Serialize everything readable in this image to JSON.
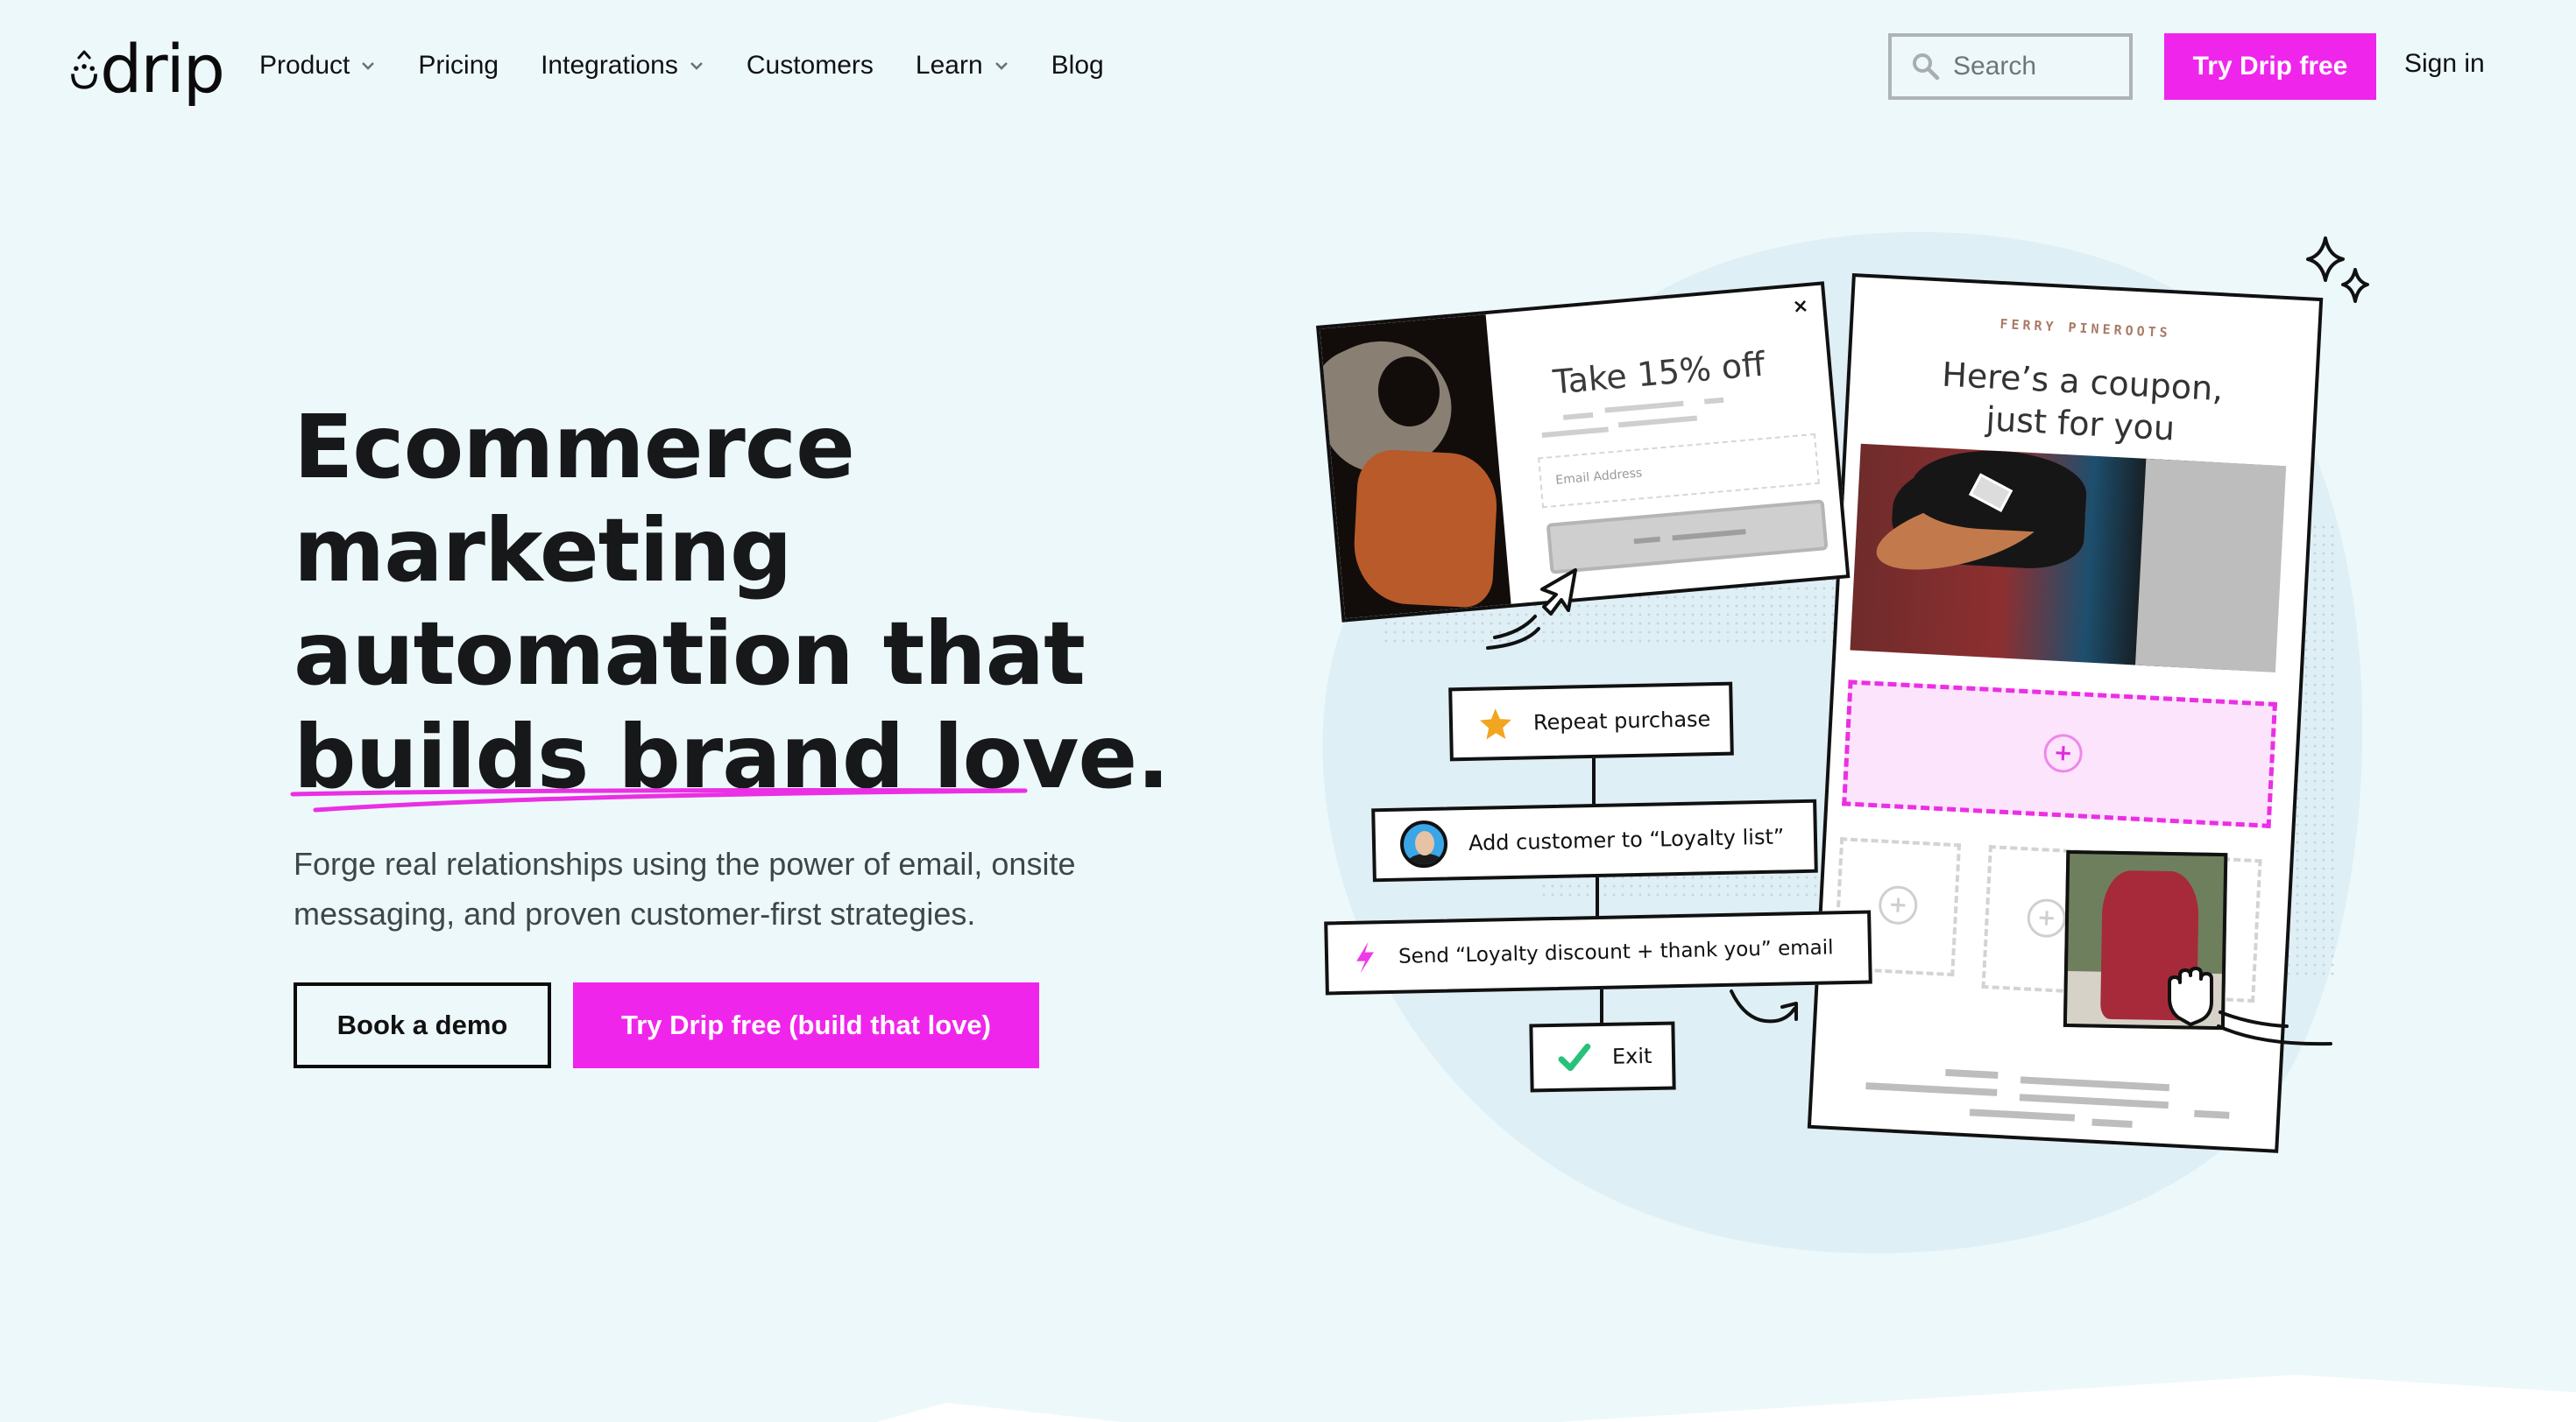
{
  "brand": {
    "logo_text": "drip",
    "accent_color": "#f025ec"
  },
  "nav": {
    "items": [
      {
        "label": "Product",
        "has_dropdown": true
      },
      {
        "label": "Pricing",
        "has_dropdown": false
      },
      {
        "label": "Integrations",
        "has_dropdown": true
      },
      {
        "label": "Customers",
        "has_dropdown": false
      },
      {
        "label": "Learn",
        "has_dropdown": true
      },
      {
        "label": "Blog",
        "has_dropdown": false
      }
    ],
    "search": {
      "placeholder": "Search",
      "value": ""
    },
    "cta_label": "Try Drip free",
    "signin_label": "Sign in"
  },
  "hero": {
    "headline_lines": [
      "Ecommerce",
      "marketing",
      "automation that",
      "builds brand love."
    ],
    "subtext": "Forge real relationships using the power of email, onsite messaging, and proven customer-first strategies.",
    "primary_button": "Try Drip free (build that love)",
    "secondary_button": "Book a demo"
  },
  "illustration": {
    "popup": {
      "title": "Take 15% off",
      "email_placeholder": "Email Address",
      "close_glyph": "×"
    },
    "email": {
      "brand_name": "FERRY PINEROOTS",
      "title_line1": "Here’s a coupon,",
      "title_line2": "just for you"
    },
    "workflow": [
      {
        "label": "Repeat purchase",
        "icon": "star-icon"
      },
      {
        "label": "Add customer to “Loyalty list”",
        "icon": "avatar"
      },
      {
        "label": "Send “Loyalty discount + thank you” email",
        "icon": "lightning-icon"
      },
      {
        "label": "Exit",
        "icon": "checkmark-icon"
      }
    ]
  }
}
